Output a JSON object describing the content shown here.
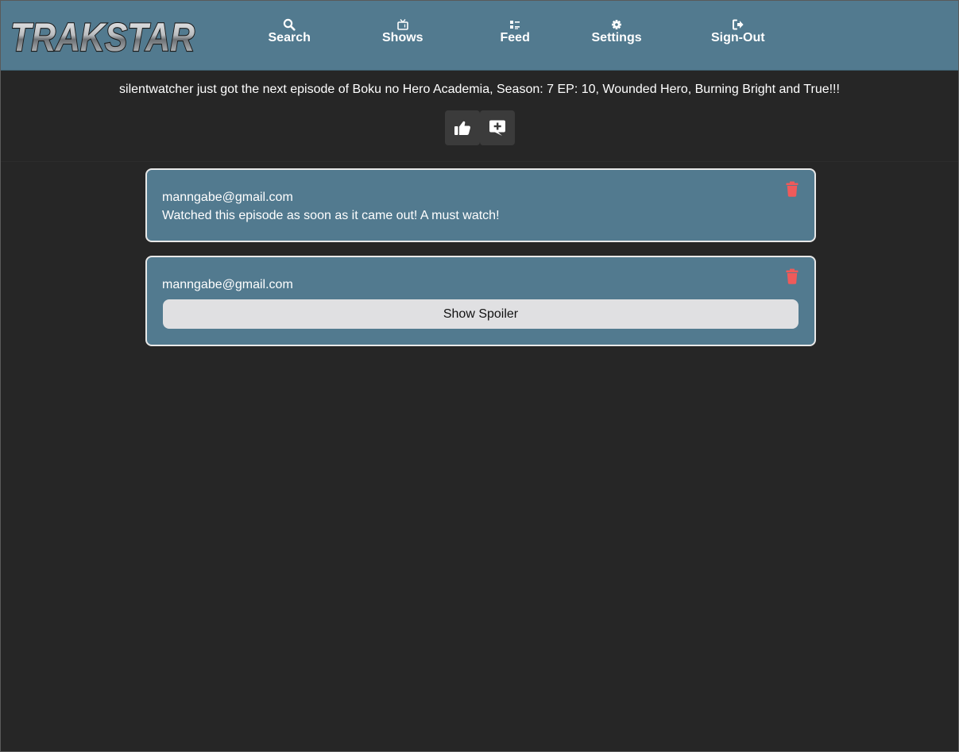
{
  "app": {
    "logo_text": "TRAKSTAR"
  },
  "nav": {
    "items": [
      {
        "label": "Search",
        "icon": "search-icon"
      },
      {
        "label": "Shows",
        "icon": "tv-icon"
      },
      {
        "label": "Feed",
        "icon": "list-icon"
      },
      {
        "label": "Settings",
        "icon": "gear-icon"
      },
      {
        "label": "Sign-Out",
        "icon": "sign-out-icon"
      }
    ]
  },
  "post": {
    "text": "silentwatcher just got the next episode of Boku no Hero Academia, Season: 7 EP: 10, Wounded Hero, Burning Bright and True!!!",
    "like_icon": "thumbs-up-icon",
    "comment_icon": "comment-add-icon"
  },
  "comments": [
    {
      "author": "manngabe@gmail.com",
      "body": "Watched this episode as soon as it came out! A must watch!",
      "delete_icon": "trash-icon"
    },
    {
      "author": "manngabe@gmail.com",
      "spoiler_label": "Show Spoiler",
      "delete_icon": "trash-icon"
    }
  ],
  "colors": {
    "header_bg": "#527a8f",
    "page_bg": "#262626",
    "card_bg": "#527a8f",
    "card_border": "#e8e8e8",
    "delete_red": "#f05a5a",
    "action_btn_bg": "#3b3b3b",
    "spoiler_btn_bg": "#e0e0e2"
  }
}
